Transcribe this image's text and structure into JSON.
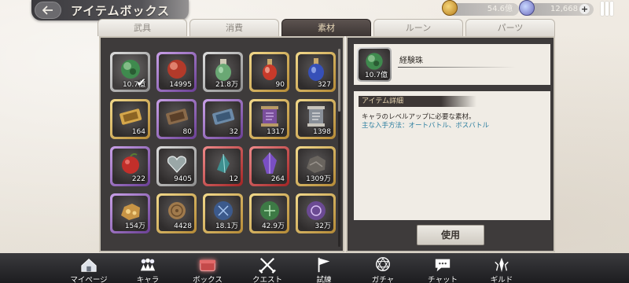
{
  "title": "アイテムボックス",
  "back_icon": "back-arrow-icon",
  "currency": {
    "gold": "54.6億",
    "gems": "12,668"
  },
  "tabs": [
    {
      "label": "武具",
      "active": false
    },
    {
      "label": "消費",
      "active": false
    },
    {
      "label": "素材",
      "active": true
    },
    {
      "label": "ルーン",
      "active": false
    },
    {
      "label": "パーツ",
      "active": false
    }
  ],
  "items": [
    {
      "qty": "10.7億",
      "frame": "gray",
      "icon": "green-orb",
      "selected": true
    },
    {
      "qty": "14995",
      "frame": "purple",
      "icon": "red-orb"
    },
    {
      "qty": "21.8万",
      "frame": "gray",
      "icon": "green-potion"
    },
    {
      "qty": "90",
      "frame": "gold",
      "icon": "red-potion"
    },
    {
      "qty": "327",
      "frame": "gold",
      "icon": "blue-potion"
    },
    {
      "qty": "164",
      "frame": "gold",
      "icon": "gold-ticket"
    },
    {
      "qty": "80",
      "frame": "purple",
      "icon": "brown-ticket"
    },
    {
      "qty": "32",
      "frame": "purple",
      "icon": "blue-ticket"
    },
    {
      "qty": "1317",
      "frame": "gold",
      "icon": "purple-scroll"
    },
    {
      "qty": "1398",
      "frame": "gold",
      "icon": "gray-scroll"
    },
    {
      "qty": "222",
      "frame": "purple",
      "icon": "red-apple"
    },
    {
      "qty": "9405",
      "frame": "gray",
      "icon": "heart-stone"
    },
    {
      "qty": "12",
      "frame": "red",
      "icon": "teal-shard"
    },
    {
      "qty": "264",
      "frame": "red",
      "icon": "purple-crystal"
    },
    {
      "qty": "1309万",
      "frame": "gold",
      "icon": "ore-rock"
    },
    {
      "qty": "154万",
      "frame": "purple",
      "icon": "gold-ore"
    },
    {
      "qty": "4428",
      "frame": "gold",
      "icon": "brown-coin"
    },
    {
      "qty": "18.1万",
      "frame": "gold",
      "icon": "blue-rune-orb"
    },
    {
      "qty": "42.9万",
      "frame": "gold",
      "icon": "green-rune-orb"
    },
    {
      "qty": "32万",
      "frame": "gold",
      "icon": "purple-rune-orb"
    }
  ],
  "selected_item": {
    "name": "経験珠",
    "qty": "10.7億",
    "icon": "green-orb"
  },
  "detail": {
    "header": "アイテム詳細",
    "description": "キャラのレベルアップに必要な素材。",
    "source": "主な入手方法：オートバトル、ボスバトル"
  },
  "use_button": "使用",
  "nav": [
    {
      "label": "マイページ",
      "icon": "home-icon"
    },
    {
      "label": "キャラ",
      "icon": "characters-icon"
    },
    {
      "label": "ボックス",
      "icon": "box-icon",
      "active": true
    },
    {
      "label": "クエスト",
      "icon": "crossed-swords-icon"
    },
    {
      "label": "試練",
      "icon": "flag-icon"
    },
    {
      "label": "ガチャ",
      "icon": "summon-circle-icon"
    },
    {
      "label": "チャット",
      "icon": "chat-icon"
    },
    {
      "label": "ギルド",
      "icon": "guild-icon"
    }
  ],
  "colors": {
    "panel": "#3e3b3b",
    "active_tab": "#3d3634",
    "detail_link": "#2e7fa0",
    "frame_gold": "#d9b45a",
    "frame_purple": "#9b67c9",
    "frame_red": "#c23c3c",
    "frame_gray": "#b6b6b6"
  }
}
